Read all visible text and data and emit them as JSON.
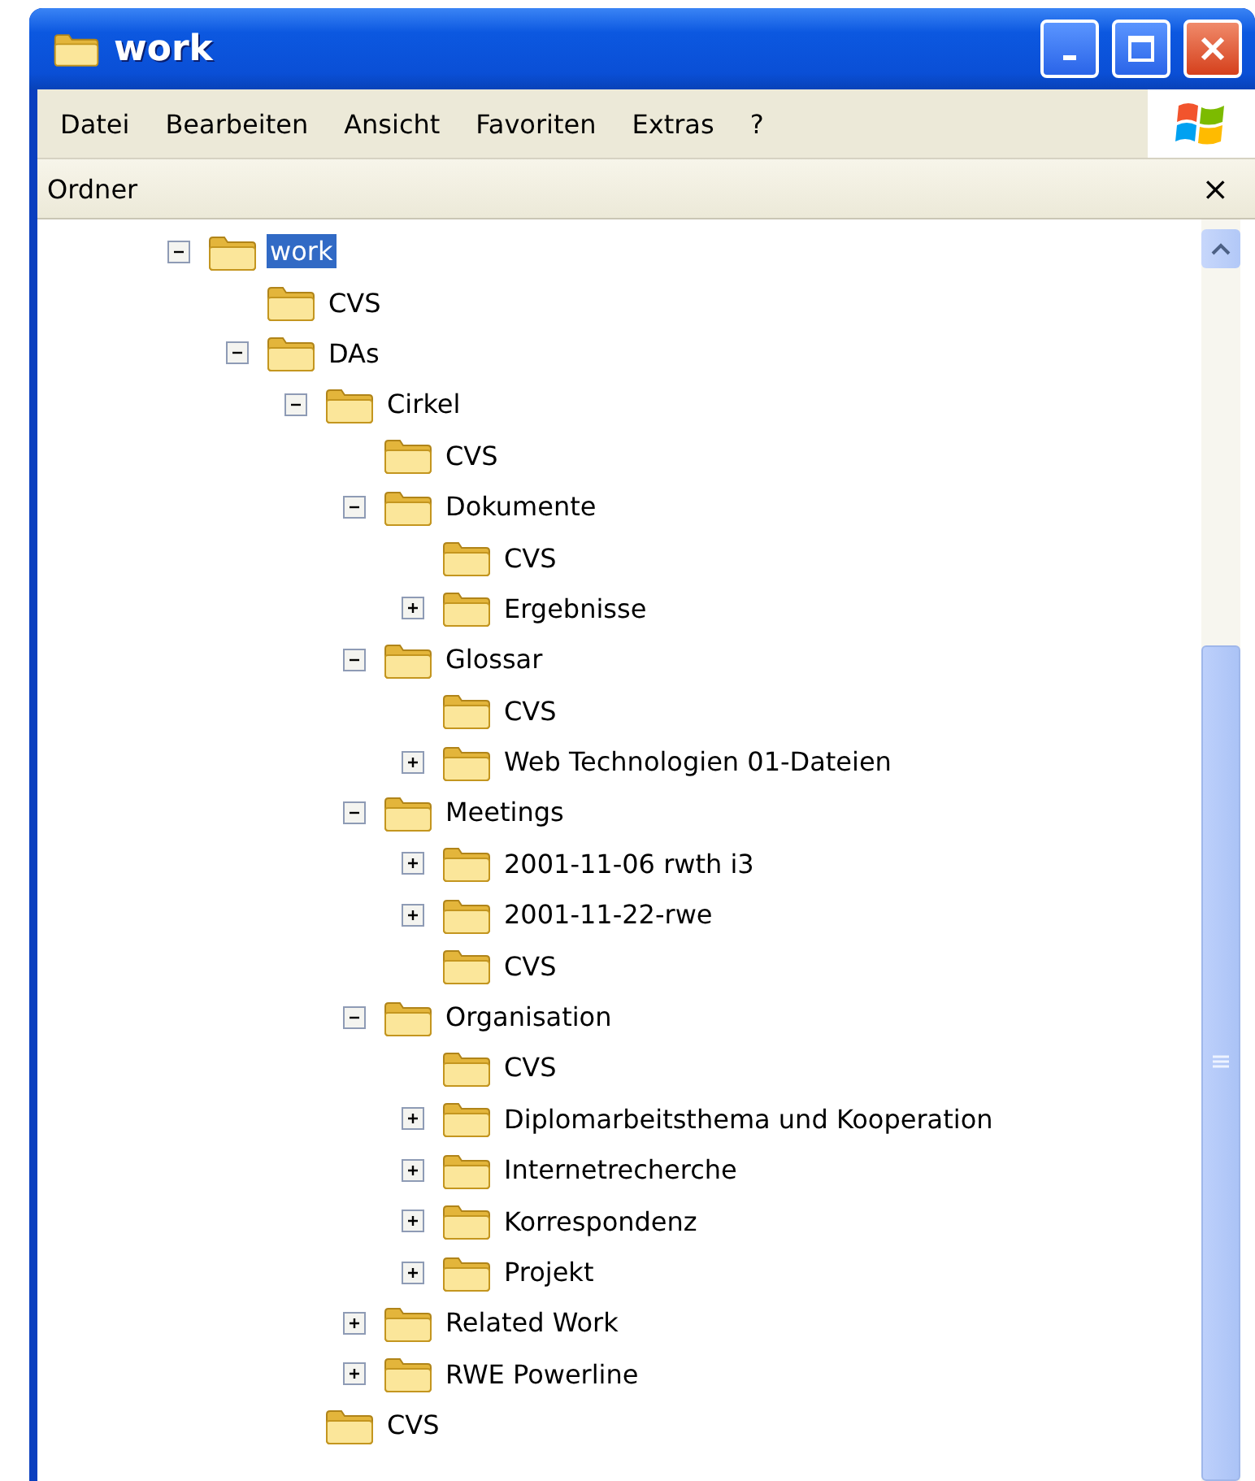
{
  "window": {
    "title": "work"
  },
  "menu": [
    {
      "label": "Datei"
    },
    {
      "label": "Bearbeiten"
    },
    {
      "label": "Ansicht"
    },
    {
      "label": "Favoriten"
    },
    {
      "label": "Extras"
    },
    {
      "label": "?"
    }
  ],
  "pane": {
    "title": "Ordner",
    "close": "×"
  },
  "tree": [
    {
      "label": "work",
      "kind": "branch",
      "expanded": true,
      "selected": true,
      "children": [
        {
          "label": "CVS",
          "kind": "leaf",
          "selected": false
        },
        {
          "label": "DAs",
          "kind": "branch",
          "expanded": true,
          "selected": false,
          "children": [
            {
              "label": "Cirkel",
              "kind": "branch",
              "expanded": true,
              "selected": false,
              "children": [
                {
                  "label": "CVS",
                  "kind": "leaf",
                  "selected": false
                },
                {
                  "label": "Dokumente",
                  "kind": "branch",
                  "expanded": true,
                  "selected": false,
                  "children": [
                    {
                      "label": "CVS",
                      "kind": "leaf",
                      "selected": false
                    },
                    {
                      "label": "Ergebnisse",
                      "kind": "branch",
                      "expanded": false,
                      "selected": false
                    }
                  ]
                },
                {
                  "label": "Glossar",
                  "kind": "branch",
                  "expanded": true,
                  "selected": false,
                  "children": [
                    {
                      "label": "CVS",
                      "kind": "leaf",
                      "selected": false
                    },
                    {
                      "label": "Web Technologien 01-Dateien",
                      "kind": "branch",
                      "expanded": false,
                      "selected": false
                    }
                  ]
                },
                {
                  "label": "Meetings",
                  "kind": "branch",
                  "expanded": true,
                  "selected": false,
                  "children": [
                    {
                      "label": "2001-11-06 rwth i3",
                      "kind": "branch",
                      "expanded": false,
                      "selected": false
                    },
                    {
                      "label": "2001-11-22-rwe",
                      "kind": "branch",
                      "expanded": false,
                      "selected": false
                    },
                    {
                      "label": "CVS",
                      "kind": "leaf",
                      "selected": false
                    }
                  ]
                },
                {
                  "label": "Organisation",
                  "kind": "branch",
                  "expanded": true,
                  "selected": false,
                  "children": [
                    {
                      "label": "CVS",
                      "kind": "leaf",
                      "selected": false
                    },
                    {
                      "label": "Diplomarbeitsthema und Kooperation",
                      "kind": "branch",
                      "expanded": false,
                      "selected": false
                    },
                    {
                      "label": "Internetrecherche",
                      "kind": "branch",
                      "expanded": false,
                      "selected": false
                    },
                    {
                      "label": "Korrespondenz",
                      "kind": "branch",
                      "expanded": false,
                      "selected": false
                    },
                    {
                      "label": "Projekt",
                      "kind": "branch",
                      "expanded": false,
                      "selected": false
                    }
                  ]
                },
                {
                  "label": "Related Work",
                  "kind": "branch",
                  "expanded": false,
                  "selected": false
                },
                {
                  "label": "RWE Powerline",
                  "kind": "branch",
                  "expanded": false,
                  "selected": false
                }
              ]
            },
            {
              "label": "CVS",
              "kind": "leaf",
              "selected": false
            }
          ]
        }
      ]
    }
  ]
}
